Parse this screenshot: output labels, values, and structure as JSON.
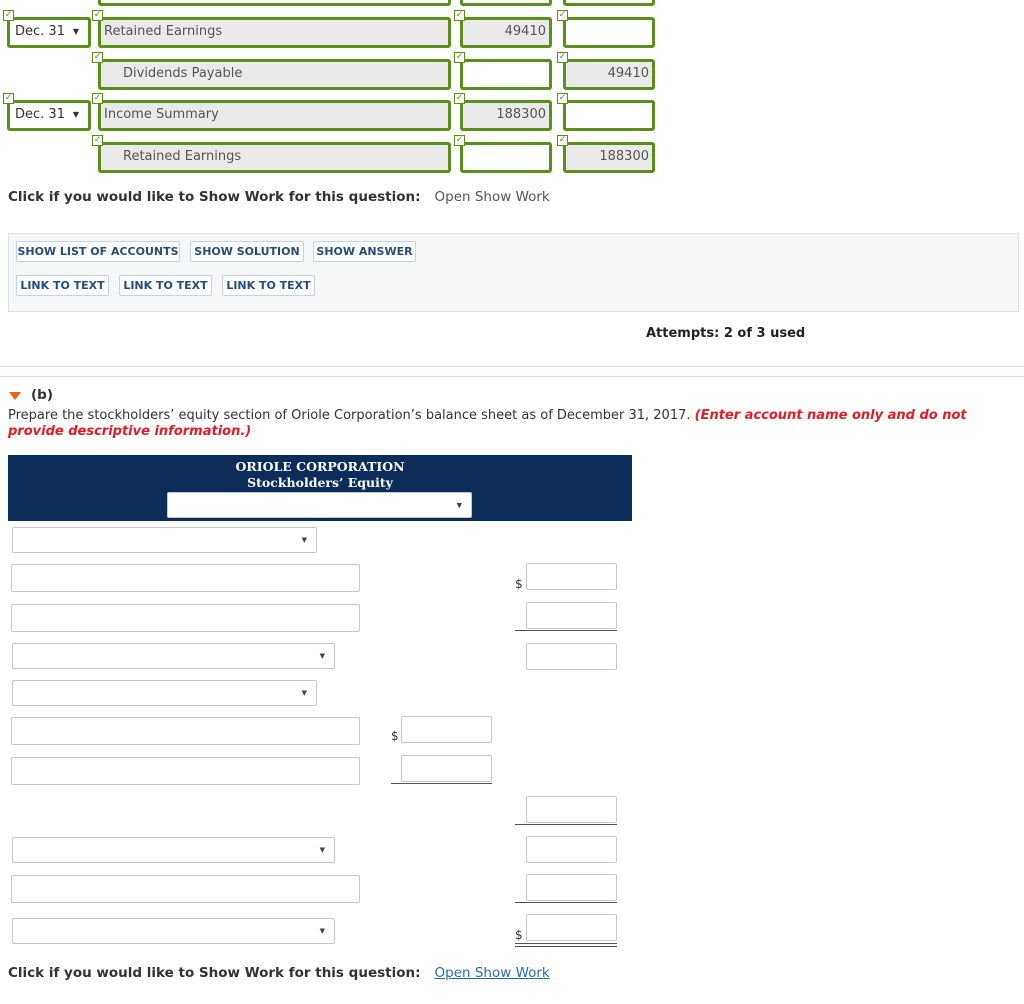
{
  "journal": {
    "rows": [
      {
        "date": "Dec. 31",
        "account": "Retained Earnings",
        "debit": "49410",
        "credit": ""
      },
      {
        "date": "",
        "account": "Dividends Payable",
        "debit": "",
        "credit": "49410"
      },
      {
        "date": "Dec. 31",
        "account": "Income Summary",
        "debit": "188300",
        "credit": ""
      },
      {
        "date": "",
        "account": "Retained Earnings",
        "debit": "",
        "credit": "188300"
      }
    ]
  },
  "show_work_a": {
    "prompt": "Click if you would like to Show Work for this question:",
    "link": "Open Show Work"
  },
  "buttons": {
    "show_list": "SHOW LIST OF ACCOUNTS",
    "show_solution": "SHOW SOLUTION",
    "show_answer": "SHOW ANSWER",
    "link1": "LINK TO TEXT",
    "link2": "LINK TO TEXT",
    "link3": "LINK TO TEXT"
  },
  "attempts": "Attempts: 2 of 3 used",
  "part_b": {
    "label": "(b)",
    "instruction": "Prepare the stockholders’ equity section of Oriole Corporation’s balance sheet as of December 31, 2017.",
    "instruction_red": "(Enter account name only and do not provide descriptive information.)",
    "company": "ORIOLE CORPORATION",
    "statement": "Stockholders’ Equity"
  },
  "currency": "$",
  "show_work_b": {
    "prompt": "Click if you would like to Show Work for this question:",
    "link": "Open Show Work"
  },
  "colors": {
    "green": "#5a8f1b",
    "navy": "#0c2c5a",
    "orange": "#e8641b",
    "red": "#e51b24"
  }
}
